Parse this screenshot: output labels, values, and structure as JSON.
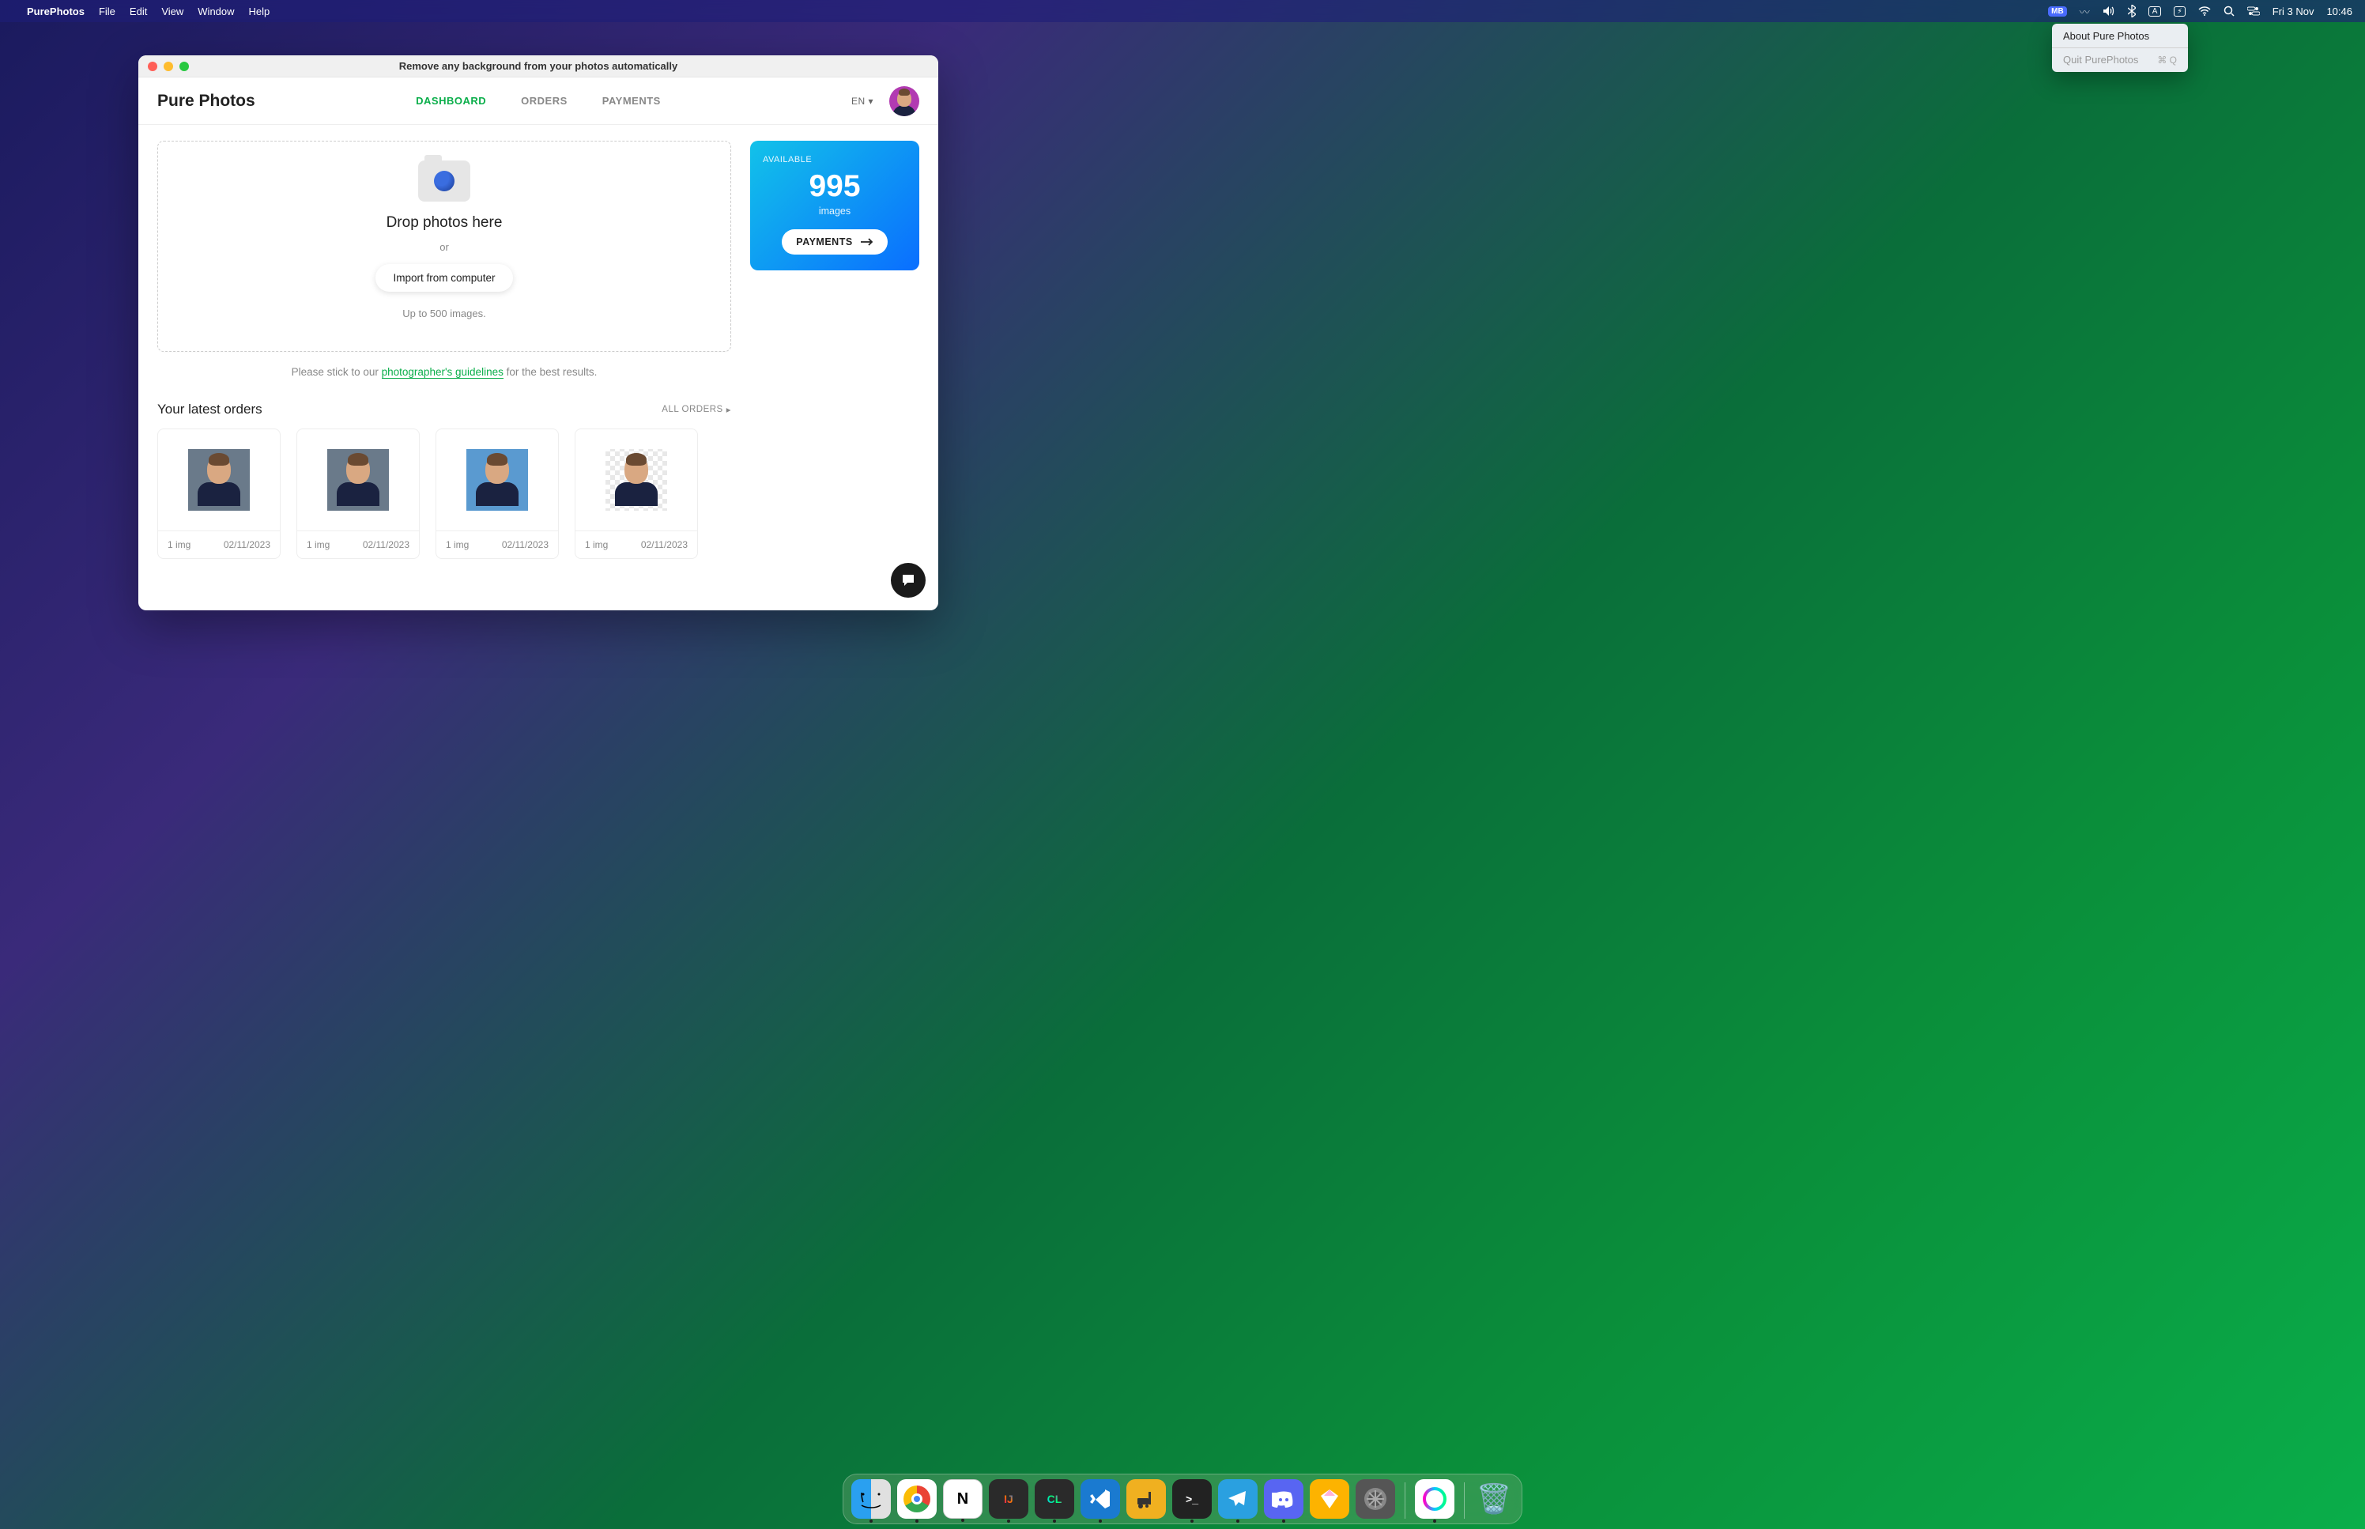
{
  "menubar": {
    "app": "PurePhotos",
    "items": [
      "File",
      "Edit",
      "View",
      "Window",
      "Help"
    ],
    "date": "Fri 3 Nov",
    "time": "10:46",
    "mb_label": "MB",
    "kbd": "A"
  },
  "tray_menu": {
    "about": "About Pure Photos",
    "quit": "Quit PurePhotos",
    "quit_shortcut": "⌘ Q"
  },
  "window": {
    "title": "Remove any background from your photos automatically"
  },
  "header": {
    "brand": "Pure Photos",
    "tabs": {
      "dashboard": "DASHBOARD",
      "orders": "ORDERS",
      "payments": "PAYMENTS"
    },
    "lang": "EN"
  },
  "dropzone": {
    "title": "Drop photos here",
    "or": "or",
    "import": "Import from computer",
    "limit": "Up to 500 images."
  },
  "guidelines": {
    "prefix": "Please stick to our ",
    "link": "photographer's guidelines",
    "suffix": " for the best results."
  },
  "available": {
    "label": "AVAILABLE",
    "count": "995",
    "unit": "images",
    "button": "PAYMENTS"
  },
  "orders": {
    "title": "Your latest orders",
    "all": "ALL ORDERS",
    "items": [
      {
        "count": "1 img",
        "date": "02/11/2023"
      },
      {
        "count": "1 img",
        "date": "02/11/2023"
      },
      {
        "count": "1 img",
        "date": "02/11/2023"
      },
      {
        "count": "1 img",
        "date": "02/11/2023"
      }
    ]
  }
}
